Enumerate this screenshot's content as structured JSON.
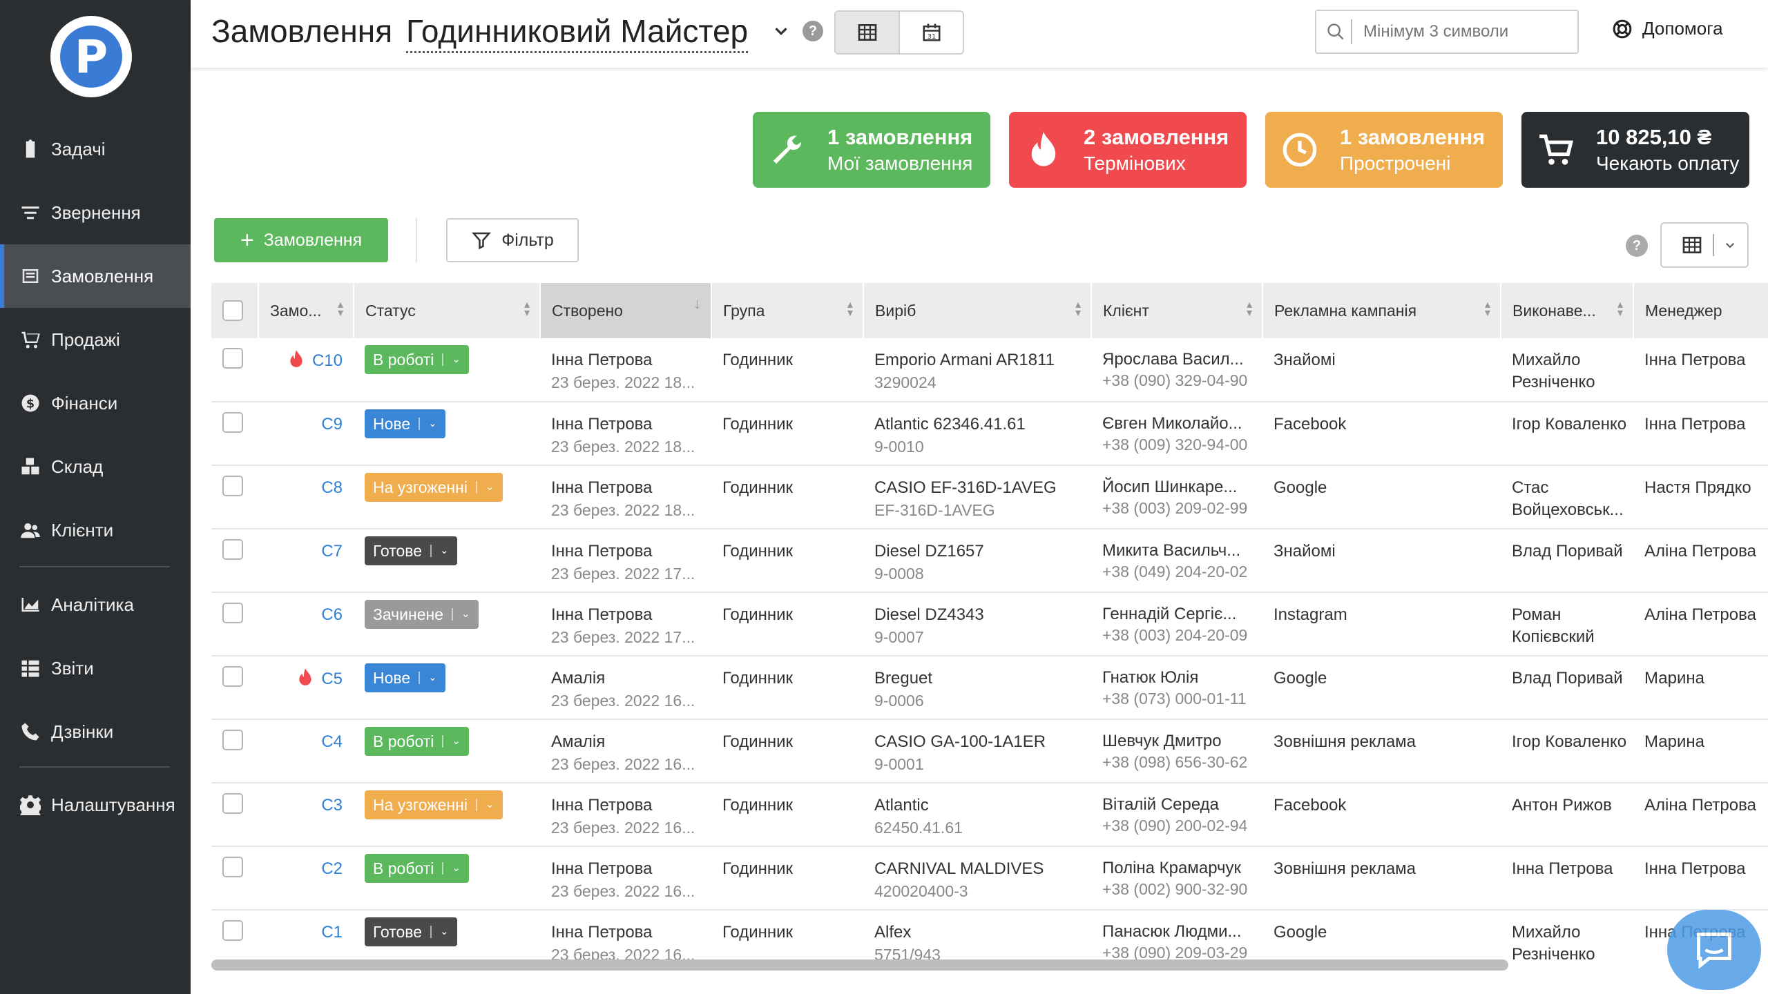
{
  "sidebar": {
    "logo_letter": "P",
    "items": [
      {
        "label": "Задачі",
        "icon": "clipboard-icon"
      },
      {
        "label": "Звернення",
        "icon": "filter-lines-icon"
      },
      {
        "label": "Замовлення",
        "icon": "orders-icon",
        "active": true
      },
      {
        "label": "Продажі",
        "icon": "cart-icon"
      },
      {
        "label": "Фінанси",
        "icon": "dollar-icon"
      },
      {
        "label": "Склад",
        "icon": "boxes-icon"
      },
      {
        "label": "Клієнти",
        "icon": "users-icon"
      },
      {
        "label": "Аналітика",
        "icon": "chart-area-icon"
      },
      {
        "label": "Звіти",
        "icon": "table-list-icon"
      },
      {
        "label": "Дзвінки",
        "icon": "phone-icon"
      },
      {
        "label": "Налаштування",
        "icon": "gear-icon"
      }
    ]
  },
  "header": {
    "title": "Замовлення",
    "subtitle": "Годинниковий Майстер",
    "help": "?",
    "search_placeholder": "Мінімум 3 символи",
    "help_link": "Допомога"
  },
  "cards": [
    {
      "title": "1 замовлення",
      "sub": "Мої замовлення",
      "icon": "wrench-icon",
      "color": "#5cb85c"
    },
    {
      "title": "2 замовлення",
      "sub": "Термінових",
      "icon": "flame-icon",
      "color": "#f04a4f"
    },
    {
      "title": "1 замовлення",
      "sub": "Прострочені",
      "icon": "clock-icon",
      "color": "#f0ad4e"
    },
    {
      "title": "10 825,10 ₴",
      "sub": "Чекають оплату",
      "icon": "cart-icon",
      "color": "#2b2e31"
    }
  ],
  "toolbar": {
    "add_label": "Замовлення",
    "filter_label": "Фільтр",
    "help": "?"
  },
  "table": {
    "columns": [
      "Замо...",
      "Статус",
      "Створено",
      "Група",
      "Виріб",
      "Клієнт",
      "Рекламна кампанія",
      "Виконаве...",
      "Менеджер"
    ],
    "rows": [
      {
        "urgent": true,
        "num": "C10",
        "status": "В роботі",
        "status_color": "#5cb85c",
        "author": "Інна Петрова",
        "date": "23 берез. 2022 18...",
        "group": "Годинник",
        "product": "Emporio Armani AR1811",
        "product_code": "3290024",
        "client": "Ярослава Васил...",
        "phone": "+38 (090) 329-04-90",
        "campaign": "Знайомі",
        "executor": "Михайло Резніченко",
        "manager": "Інна Петрова"
      },
      {
        "urgent": false,
        "num": "C9",
        "status": "Нове",
        "status_color": "#3a86d6",
        "author": "Інна Петрова",
        "date": "23 берез. 2022 18...",
        "group": "Годинник",
        "product": "Atlantic 62346.41.61",
        "product_code": "9-0010",
        "client": "Євген Миколайо...",
        "phone": "+38 (009) 320-94-00",
        "campaign": "Facebook",
        "executor": "Ігор Коваленко",
        "manager": "Інна Петрова"
      },
      {
        "urgent": false,
        "num": "C8",
        "status": "На узгоженні",
        "status_color": "#f0ad4e",
        "author": "Інна Петрова",
        "date": "23 берез. 2022 18...",
        "group": "Годинник",
        "product": "CASIO EF-316D-1AVEG",
        "product_code": "EF-316D-1AVEG",
        "client": "Йосип Шинкаре...",
        "phone": "+38 (003) 209-02-99",
        "campaign": "Google",
        "executor": "Стас Войцеховськ...",
        "manager": "Настя Прядко"
      },
      {
        "urgent": false,
        "num": "C7",
        "status": "Готове",
        "status_color": "#4a4a4a",
        "author": "Інна Петрова",
        "date": "23 берез. 2022 17...",
        "group": "Годинник",
        "product": "Diesel DZ1657",
        "product_code": "9-0008",
        "client": "Микита Васильч...",
        "phone": "+38 (049) 204-20-02",
        "campaign": "Знайомі",
        "executor": "Влад Поривай",
        "manager": "Аліна Петрова"
      },
      {
        "urgent": false,
        "num": "C6",
        "status": "Зачинене",
        "status_color": "#9a9a9a",
        "author": "Інна Петрова",
        "date": "23 берез. 2022 17...",
        "group": "Годинник",
        "product": "Diesel DZ4343",
        "product_code": "9-0007",
        "client": "Геннадій Сергіє...",
        "phone": "+38 (003) 204-20-09",
        "campaign": "Instagram",
        "executor": "Роман Копієвский",
        "manager": "Аліна Петрова"
      },
      {
        "urgent": true,
        "num": "C5",
        "status": "Нове",
        "status_color": "#3a86d6",
        "author": "Амалія",
        "date": "23 берез. 2022 16...",
        "group": "Годинник",
        "product": "Breguet",
        "product_code": "9-0006",
        "client": "Гнатюк Юлія",
        "phone": "+38 (073) 000-01-11",
        "campaign": "Google",
        "executor": "Влад Поривай",
        "manager": "Марина"
      },
      {
        "urgent": false,
        "num": "C4",
        "status": "В роботі",
        "status_color": "#5cb85c",
        "author": "Амалія",
        "date": "23 берез. 2022 16...",
        "group": "Годинник",
        "product": "CASIO GA-100-1A1ER",
        "product_code": "9-0001",
        "client": "Шевчук Дмитро",
        "phone": "+38 (098) 656-30-62",
        "campaign": "Зовнішня реклама",
        "executor": "Ігор Коваленко",
        "manager": "Марина"
      },
      {
        "urgent": false,
        "num": "C3",
        "status": "На узгоженні",
        "status_color": "#f0ad4e",
        "author": "Інна Петрова",
        "date": "23 берез. 2022 16...",
        "group": "Годинник",
        "product": "Atlantic",
        "product_code": "62450.41.61",
        "client": "Віталій Середа",
        "phone": "+38 (090) 200-02-94",
        "campaign": "Facebook",
        "executor": "Антон Рижов",
        "manager": "Аліна Петрова"
      },
      {
        "urgent": false,
        "num": "C2",
        "status": "В роботі",
        "status_color": "#5cb85c",
        "author": "Інна Петрова",
        "date": "23 берез. 2022 16...",
        "group": "Годинник",
        "product": "CARNIVAL MALDIVES",
        "product_code": "420020400-3",
        "client": "Поліна Крамарчук",
        "phone": "+38 (002) 900-32-90",
        "campaign": "Зовнішня реклама",
        "executor": "Інна Петрова",
        "manager": "Інна Петрова"
      },
      {
        "urgent": false,
        "num": "C1",
        "status": "Готове",
        "status_color": "#4a4a4a",
        "author": "Інна Петрова",
        "date": "23 берез. 2022 16...",
        "group": "Годинник",
        "product": "Alfex",
        "product_code": "5751/943",
        "client": "Панасюк Людми...",
        "phone": "+38 (090) 209-03-29",
        "campaign": "Google",
        "executor": "Михайло Резніченко",
        "manager": "Інна Петрова"
      }
    ]
  }
}
